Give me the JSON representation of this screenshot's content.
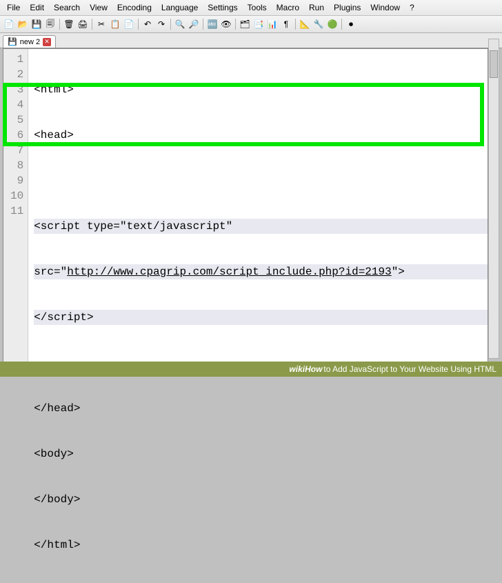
{
  "menu": {
    "items": [
      "File",
      "Edit",
      "Search",
      "View",
      "Encoding",
      "Language",
      "Settings",
      "Tools",
      "Macro",
      "Run",
      "Plugins",
      "Window",
      "?"
    ]
  },
  "toolbar_icons": [
    "📄",
    "📂",
    "💾",
    "🗐",
    "🗑",
    "🖨",
    "✂",
    "📋",
    "📄",
    "↶",
    "↷",
    "🔍",
    "🔎",
    "🔤",
    "👁",
    "🗂",
    "📑",
    "📊",
    "¶",
    "📐",
    "🔧",
    "🟢",
    "⏺"
  ],
  "tab": {
    "icon": "💾",
    "label": "new 2",
    "close": "✕"
  },
  "code": {
    "lines": [
      {
        "n": 1,
        "text": "<html>"
      },
      {
        "n": 2,
        "text": "<head>"
      },
      {
        "n": 3,
        "text": ""
      },
      {
        "n": 4,
        "text": "<script type=\"text/javascript\""
      },
      {
        "n": 5,
        "pre": "src=\"",
        "url": "http://www.cpagrip.com/script_include.php?id=2193",
        "post": "\">"
      },
      {
        "n": 6,
        "text": "</script>"
      },
      {
        "n": 7,
        "text": ""
      },
      {
        "n": 8,
        "text": "</head>"
      },
      {
        "n": 9,
        "text": "<body>"
      },
      {
        "n": 10,
        "text": "</body>"
      },
      {
        "n": 11,
        "text": "</html>"
      }
    ]
  },
  "footer": {
    "brand": "wikiHow",
    "title": " to Add JavaScript to Your Website Using HTML"
  }
}
